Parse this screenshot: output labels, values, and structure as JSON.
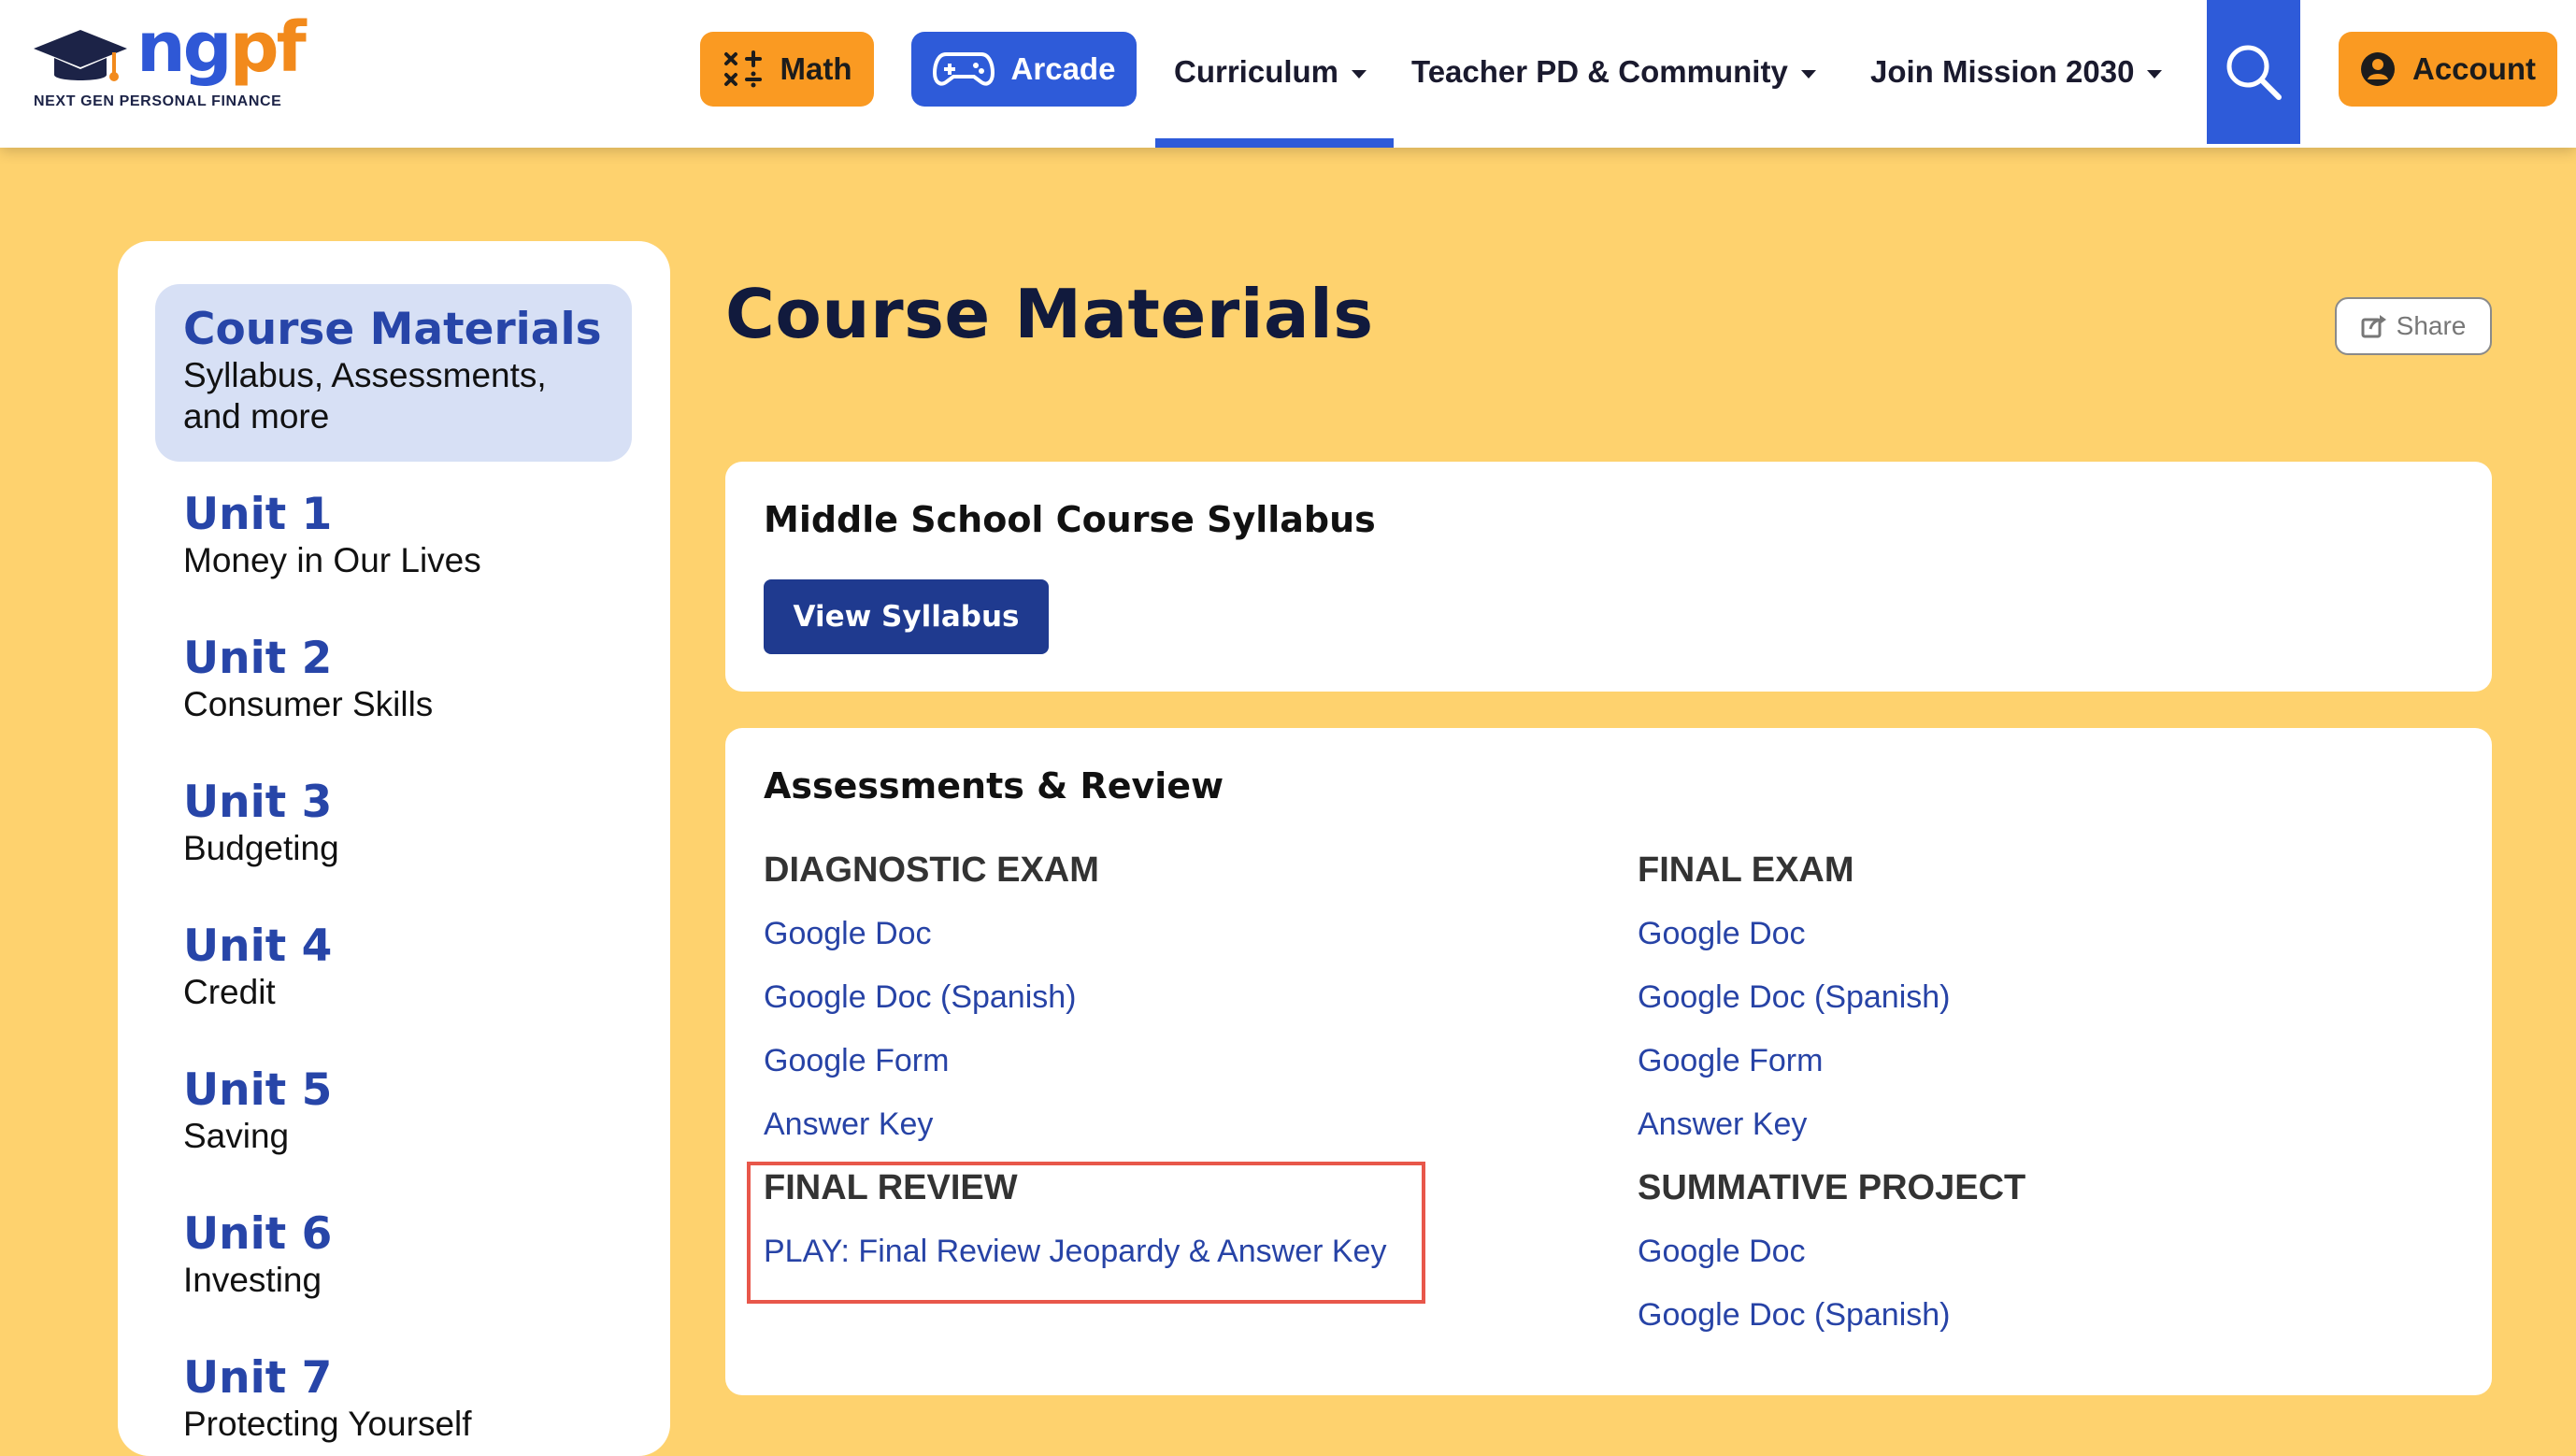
{
  "header": {
    "logo_text_ng": "ng",
    "logo_text_pf": "pf",
    "logo_tagline": "NEXT GEN PERSONAL FINANCE",
    "math_label": "Math",
    "arcade_label": "Arcade",
    "nav": [
      {
        "label": "Curriculum"
      },
      {
        "label": "Teacher PD & Community"
      },
      {
        "label": "Join Mission 2030"
      }
    ],
    "account_label": "Account",
    "colors": {
      "orange": "#fa9a22",
      "blue": "#2e5bd9"
    }
  },
  "sidebar": {
    "active": {
      "title": "Course Materials",
      "subtitle": "Syllabus, Assessments, and more"
    },
    "items": [
      {
        "title": "Unit 1",
        "subtitle": "Money in Our Lives"
      },
      {
        "title": "Unit 2",
        "subtitle": "Consumer Skills"
      },
      {
        "title": "Unit 3",
        "subtitle": "Budgeting"
      },
      {
        "title": "Unit 4",
        "subtitle": "Credit"
      },
      {
        "title": "Unit 5",
        "subtitle": "Saving"
      },
      {
        "title": "Unit 6",
        "subtitle": "Investing"
      },
      {
        "title": "Unit 7",
        "subtitle": "Protecting Yourself"
      }
    ]
  },
  "main": {
    "title": "Course Materials",
    "share_label": "Share",
    "syllabus": {
      "title": "Middle School Course Syllabus",
      "button_label": "View Syllabus"
    },
    "assessments": {
      "title": "Assessments & Review",
      "left": [
        {
          "heading": "DIAGNOSTIC EXAM",
          "links": [
            "Google Doc",
            "Google Doc (Spanish)",
            "Google Form",
            "Answer Key"
          ]
        },
        {
          "heading": "FINAL REVIEW",
          "links": [
            "PLAY: Final Review Jeopardy & Answer Key"
          ]
        }
      ],
      "right": [
        {
          "heading": "FINAL EXAM",
          "links": [
            "Google Doc",
            "Google Doc (Spanish)",
            "Google Form",
            "Answer Key"
          ]
        },
        {
          "heading": "SUMMATIVE PROJECT",
          "links": [
            "Google Doc",
            "Google Doc (Spanish)"
          ]
        }
      ]
    },
    "highlight_color": "#e8574a"
  }
}
